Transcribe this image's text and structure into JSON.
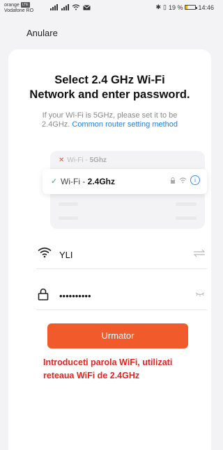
{
  "status_bar": {
    "carrier1": "orange",
    "carrier2": "Vodafone RO",
    "lte_badge": "LTE",
    "battery_text": "19 %",
    "time": "14:46",
    "battery_level_percent": 19,
    "icons": [
      "signal-icon",
      "signal-icon",
      "wifi-icon",
      "message-icon",
      "bluetooth-icon",
      "vibrate-icon"
    ]
  },
  "header": {
    "cancel_label": "Anulare"
  },
  "main": {
    "title_line1": "Select 2.4 GHz Wi-Fi",
    "title_line2": "Network and enter password.",
    "subtitle_text1": "If your Wi-Fi is 5GHz, please set it to be",
    "subtitle_text2": "2.4GHz.",
    "subtitle_link": "Common router setting method",
    "illustration": {
      "bad_prefix": "Wi-Fi - ",
      "bad_band": "5Ghz",
      "good_prefix": "Wi-Fi - ",
      "good_band": "2.4Ghz"
    },
    "wifi_field": {
      "ssid": "YLI"
    },
    "password_field": {
      "value": "••••••••••"
    },
    "next_label": "Urmator",
    "warning_line1": "Introduceti parola WiFi, utilizati",
    "warning_line2": "reteaua WiFi de 2.4GHz"
  },
  "colors": {
    "accent": "#f15a2b",
    "link": "#1e7fe0",
    "warning": "#e8231c",
    "check": "#2bb673",
    "cross": "#e74c3c"
  }
}
